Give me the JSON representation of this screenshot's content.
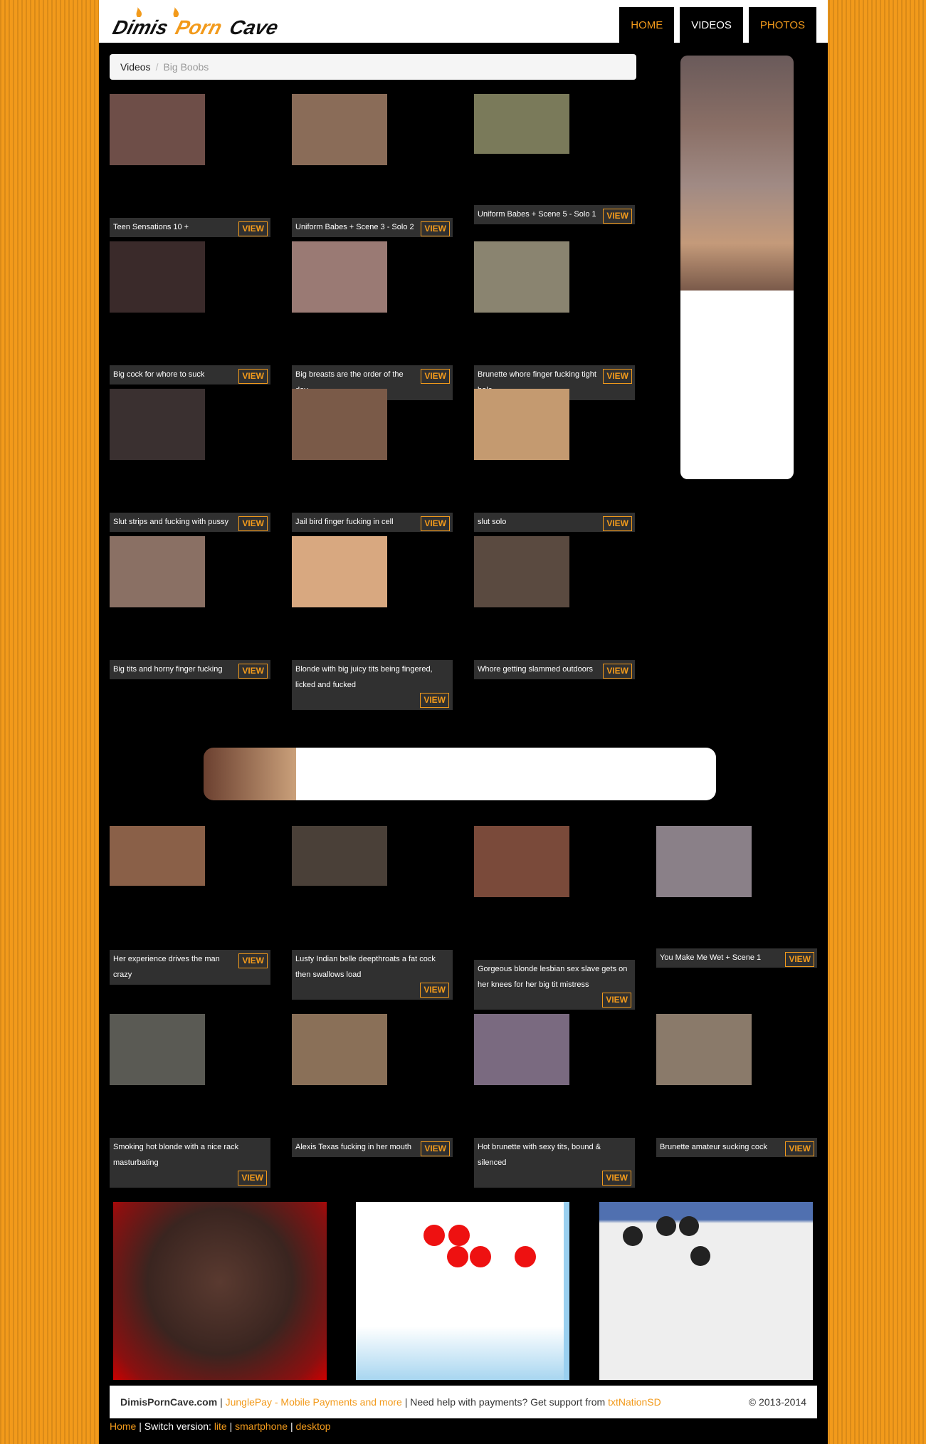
{
  "logo_text": "DimisPornCave",
  "nav": [
    {
      "label": "HOME"
    },
    {
      "label": "VIDEOS"
    },
    {
      "label": "PHOTOS"
    }
  ],
  "breadcrumb": {
    "parent": "Videos",
    "current": "Big Boobs"
  },
  "view_label": "VIEW",
  "videos": [
    {
      "title": "Teen Sensations 10 +"
    },
    {
      "title": "Uniform Babes + Scene 3 - Solo 2"
    },
    {
      "title": "Uniform Babes + Scene 5 - Solo 1"
    },
    {
      "title": "Big cock for whore to suck"
    },
    {
      "title": "Big breasts are the order of the day"
    },
    {
      "title": "Brunette whore finger fucking tight hole"
    },
    {
      "title": "Slut strips and fucking with pussy"
    },
    {
      "title": "Jail bird finger fucking in cell"
    },
    {
      "title": "slut solo"
    },
    {
      "title": "Big tits and horny finger fucking"
    },
    {
      "title": "Blonde with big juicy tits being fingered, licked and fucked"
    },
    {
      "title": "Whore getting slammed outdoors"
    },
    {
      "title": "Her experience drives the man crazy"
    },
    {
      "title": "Lusty Indian belle deepthroats a fat cock then swallows load"
    },
    {
      "title": "Gorgeous blonde lesbian sex slave gets on her knees for her big tit mistress"
    },
    {
      "title": "You Make Me Wet + Scene 1"
    },
    {
      "title": "Smoking hot blonde with a nice rack masturbating"
    },
    {
      "title": "Alexis Texas fucking in her mouth"
    },
    {
      "title": "Hot brunette with sexy tits, bound & silenced"
    },
    {
      "title": "Brunette amateur sucking cock"
    }
  ],
  "footer": {
    "site": "DimisPornCave.com",
    "sep": "|",
    "junglepay": "JunglePay - Mobile Payments and more",
    "help_text": "| Need help with payments? Get support from",
    "support_link": "txtNationSD",
    "copyright": "© 2013-2014",
    "home": "Home",
    "switch_text": "| Switch version:",
    "lite": "lite",
    "smartphone": "smartphone",
    "desktop": "desktop",
    "pipe": "|"
  },
  "colors": {
    "accent": "#f29a1b",
    "background": "#000000",
    "caption_bg": "#303030"
  }
}
